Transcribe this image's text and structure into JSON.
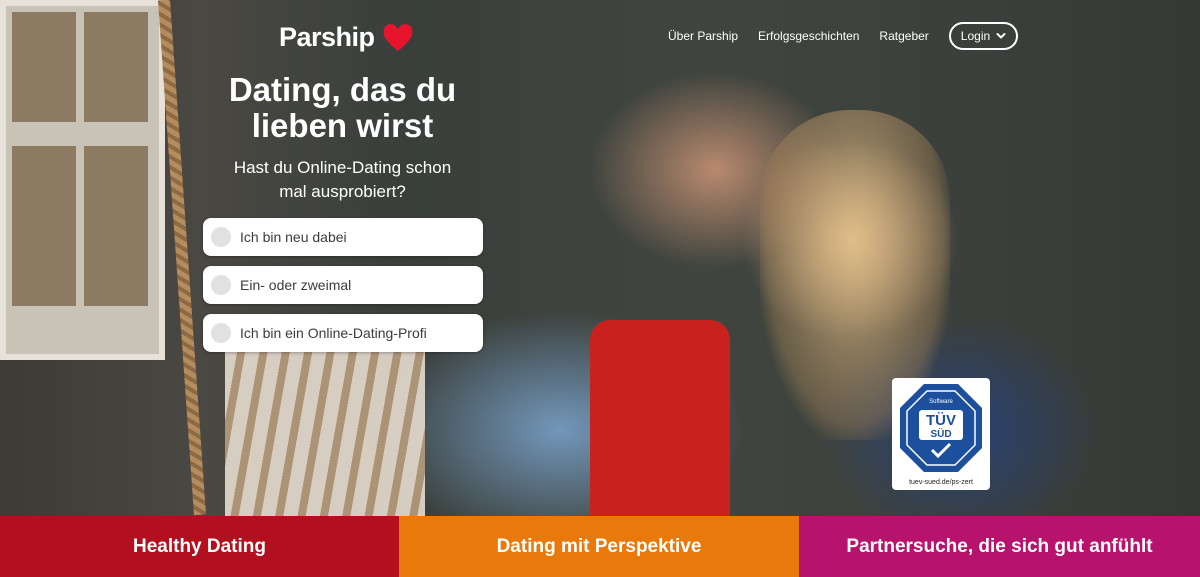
{
  "header": {
    "logo_text": "Parship",
    "nav": [
      "Über Parship",
      "Erfolgsgeschichten",
      "Ratgeber"
    ],
    "login_label": "Login"
  },
  "hero": {
    "headline_line1": "Dating, das du",
    "headline_line2": "lieben wirst",
    "question_line1": "Hast du Online-Dating schon",
    "question_line2": "mal ausprobiert?",
    "answers": [
      "Ich bin neu dabei",
      "Ein- oder zweimal",
      "Ich bin ein Online-Dating-Profi"
    ]
  },
  "badge": {
    "brand_top": "TÜV",
    "brand_bottom": "SÜD",
    "label_top": "Software",
    "url": "tuev-sued.de/ps-zert"
  },
  "bottom_bar": {
    "tiles": [
      "Healthy Dating",
      "Dating mit Perspektive",
      "Partnersuche, die sich gut anfühlt"
    ]
  },
  "colors": {
    "brand_red": "#e8132d",
    "tile_red": "#b3101f",
    "tile_orange": "#e9790b",
    "tile_magenta": "#b8136c",
    "tuv_blue": "#1c4f9c"
  }
}
